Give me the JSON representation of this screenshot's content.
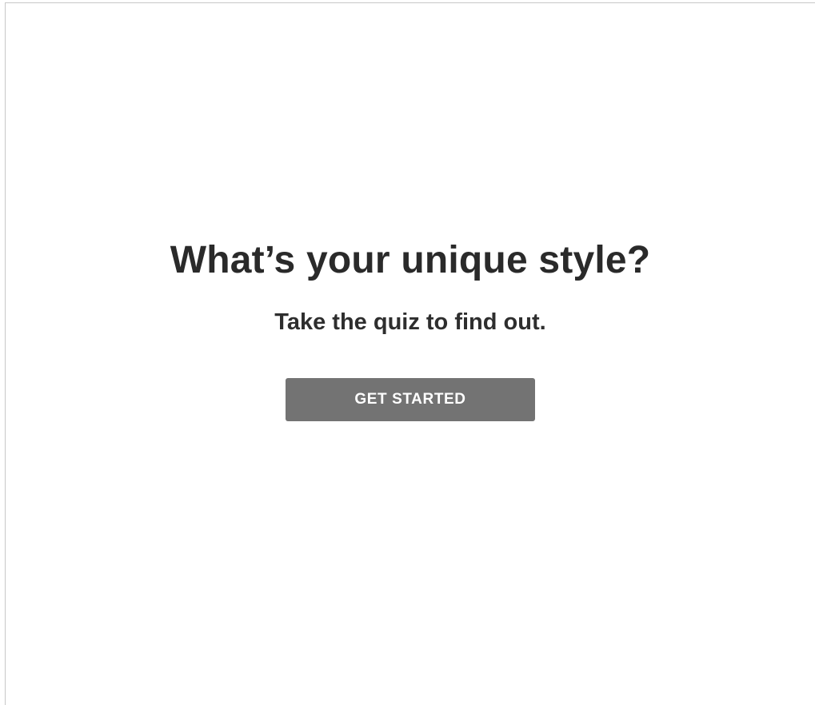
{
  "hero": {
    "headline": "What’s your unique style?",
    "subheadline": "Take the quiz to find out.",
    "cta_label": "GET STARTED"
  },
  "colors": {
    "background": "#ffffff",
    "text": "#2a2a2a",
    "button_bg": "#737373",
    "button_text": "#ffffff",
    "frame_border": "#c8c8c8"
  }
}
